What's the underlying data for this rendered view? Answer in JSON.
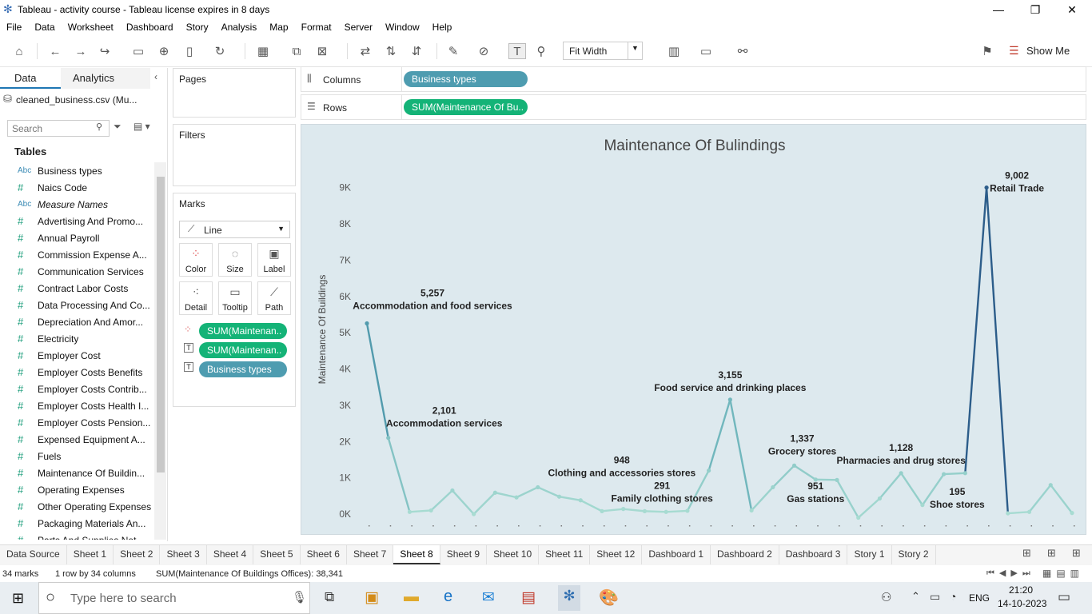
{
  "window": {
    "title": "Tableau - activity course - Tableau license expires in 8 days"
  },
  "menu": [
    "File",
    "Data",
    "Worksheet",
    "Dashboard",
    "Story",
    "Analysis",
    "Map",
    "Format",
    "Server",
    "Window",
    "Help"
  ],
  "toolbar": {
    "fit": "Fit Width",
    "show_me": "Show Me"
  },
  "data_pane": {
    "tab_data": "Data",
    "tab_analytics": "Analytics",
    "datasource": "cleaned_business.csv (Mu...",
    "search_placeholder": "Search",
    "tables_heading": "Tables",
    "fields": [
      {
        "type": "Abc",
        "name": "Business types"
      },
      {
        "type": "#",
        "name": "Naics Code"
      },
      {
        "type": "Abc",
        "name": "Measure Names"
      },
      {
        "type": "#",
        "name": "Advertising And Promo..."
      },
      {
        "type": "#",
        "name": "Annual Payroll"
      },
      {
        "type": "#",
        "name": "Commission Expense A..."
      },
      {
        "type": "#",
        "name": "Communication Services"
      },
      {
        "type": "#",
        "name": "Contract Labor Costs"
      },
      {
        "type": "#",
        "name": "Data Processing And Co..."
      },
      {
        "type": "#",
        "name": "Depreciation And Amor..."
      },
      {
        "type": "#",
        "name": "Electricity"
      },
      {
        "type": "#",
        "name": "Employer Cost"
      },
      {
        "type": "#",
        "name": "Employer Costs Benefits"
      },
      {
        "type": "#",
        "name": "Employer Costs Contrib..."
      },
      {
        "type": "#",
        "name": "Employer Costs Health I..."
      },
      {
        "type": "#",
        "name": "Employer Costs Pension..."
      },
      {
        "type": "#",
        "name": "Expensed Equipment A..."
      },
      {
        "type": "#",
        "name": "Fuels"
      },
      {
        "type": "#",
        "name": "Maintenance Of Buildin..."
      },
      {
        "type": "#",
        "name": "Operating Expenses"
      },
      {
        "type": "#",
        "name": "Other Operating Expenses"
      },
      {
        "type": "#",
        "name": "Packaging Materials An..."
      },
      {
        "type": "#",
        "name": "Parts And Supplies Not..."
      }
    ]
  },
  "cards": {
    "pages": "Pages",
    "filters": "Filters",
    "marks": "Marks",
    "mark_type": "Line",
    "mark_buttons": [
      "Color",
      "Size",
      "Label",
      "Detail",
      "Tooltip",
      "Path"
    ],
    "mark_pills": [
      "SUM(Maintenan..",
      "SUM(Maintenan..",
      "Business types"
    ]
  },
  "shelves": {
    "columns_label": "Columns",
    "columns_pill": "Business types",
    "rows_label": "Rows",
    "rows_pill": "SUM(Maintenance Of Bu.."
  },
  "chart_data": {
    "type": "line",
    "title": "Maintenance Of Bulindings",
    "ylabel": "Maintenance Of Buildings",
    "ylim": [
      0,
      9500
    ],
    "yticks": [
      "0K",
      "1K",
      "2K",
      "3K",
      "4K",
      "5K",
      "6K",
      "7K",
      "8K",
      "9K"
    ],
    "grid": false,
    "values": [
      5257,
      2101,
      60,
      100,
      650,
      0,
      590,
      460,
      740,
      480,
      380,
      80,
      140,
      80,
      60,
      90,
      1200,
      3155,
      100,
      740,
      1337,
      951,
      940,
      -100,
      430,
      1128,
      250,
      1100,
      1128,
      9002,
      20,
      60,
      800,
      30
    ],
    "annotations": [
      {
        "index": 0,
        "value": "5,257",
        "label": "Accommodation and food services"
      },
      {
        "index": 1,
        "value": "2,101",
        "label": "Accommodation services"
      },
      {
        "index": 8,
        "value": "948",
        "label": "Clothing and accessories stores"
      },
      {
        "index": 14,
        "value": "291",
        "label": "Family clothing stores"
      },
      {
        "index": 17,
        "value": "3,155",
        "label": "Food service and drinking places"
      },
      {
        "index": 20,
        "value": "1,337",
        "label": "Grocery stores"
      },
      {
        "index": 21,
        "value": "951",
        "label": "Gas stations"
      },
      {
        "index": 25,
        "value": "1,128",
        "label": "Pharmacies and drug stores"
      },
      {
        "index": 28,
        "value": "195",
        "label": "Shoe stores"
      },
      {
        "index": 29,
        "value": "9,002",
        "label": "Retail Trade"
      }
    ]
  },
  "sheet_tabs": [
    "Data Source",
    "Sheet 1",
    "Sheet 2",
    "Sheet 3",
    "Sheet 4",
    "Sheet 5",
    "Sheet 6",
    "Sheet 7",
    "Sheet 8",
    "Sheet 9",
    "Sheet 10",
    "Sheet 11",
    "Sheet 12",
    "Dashboard 1",
    "Dashboard 2",
    "Dashboard 3",
    "Story 1",
    "Story 2"
  ],
  "active_tab": "Sheet 8",
  "status": {
    "marks": "34 marks",
    "dims": "1 row by 34 columns",
    "sum": "SUM(Maintenance Of Buildings Offices): 38,341"
  },
  "taskbar": {
    "search": "Type here to search",
    "lang": "ENG",
    "time": "21:20",
    "date": "14-10-2023"
  }
}
